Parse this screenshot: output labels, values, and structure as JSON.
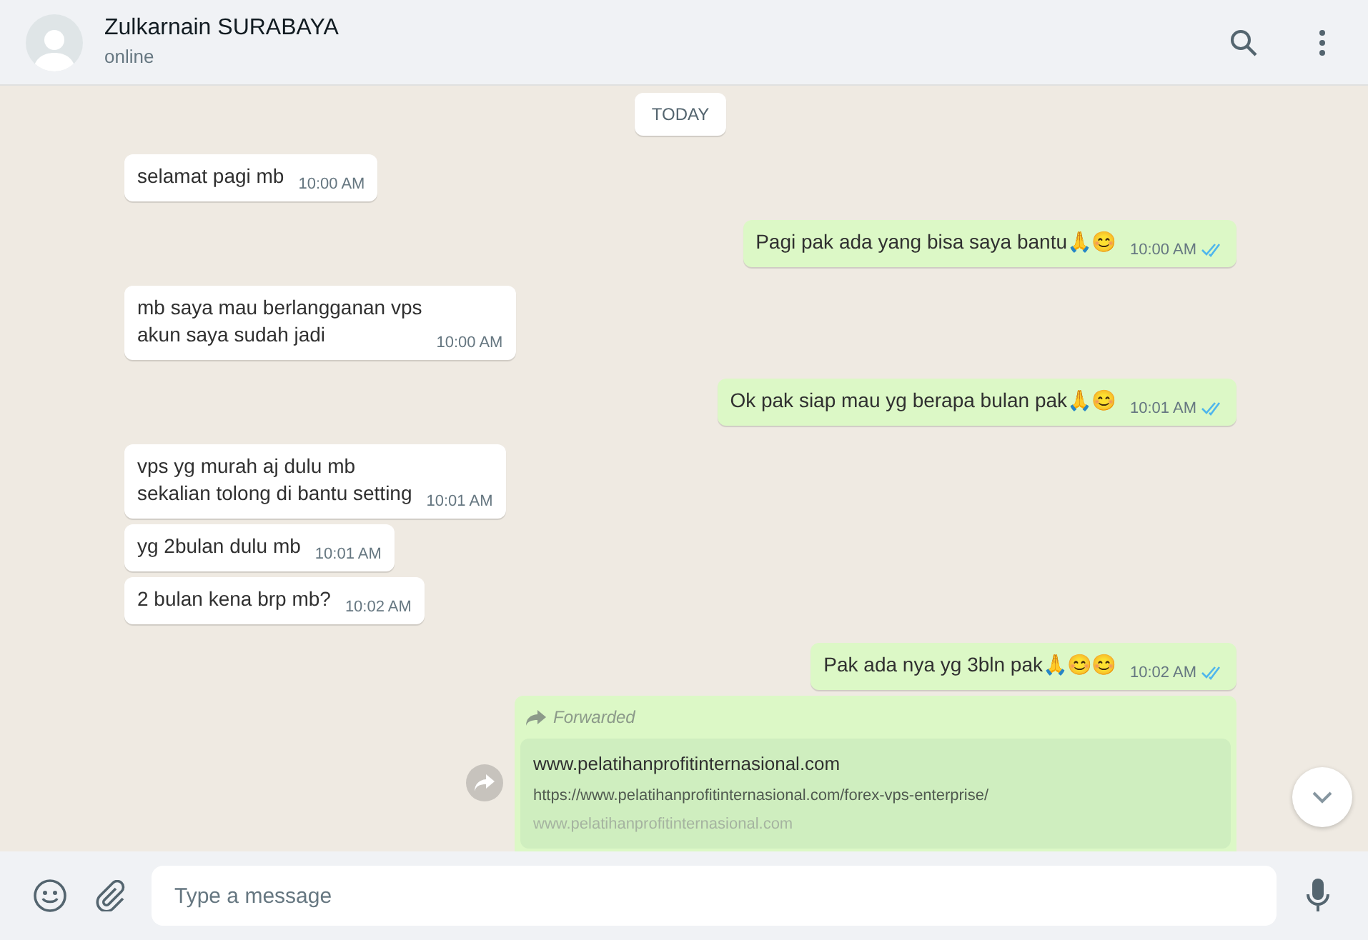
{
  "header": {
    "name": "Zulkarnain SURABAYA",
    "status": "online"
  },
  "date_chip": "TODAY",
  "messages": [
    {
      "kind": "in",
      "text": "selamat pagi mb",
      "time": "10:00 AM"
    },
    {
      "kind": "out",
      "text": "Pagi pak ada yang bisa saya bantu🙏😊",
      "time": "10:00 AM",
      "read": true
    },
    {
      "kind": "in",
      "text": "mb saya mau berlangganan vps\nakun saya sudah jadi",
      "time": "10:00 AM"
    },
    {
      "kind": "out",
      "text": "Ok pak siap mau yg berapa bulan pak🙏😊",
      "time": "10:01 AM",
      "read": true
    },
    {
      "kind": "in",
      "text": "vps yg murah aj dulu mb\nsekalian tolong di bantu setting",
      "time": "10:01 AM"
    },
    {
      "kind": "in",
      "text": "yg 2bulan dulu mb",
      "time": "10:01 AM"
    },
    {
      "kind": "in",
      "text": "2 bulan kena brp mb?",
      "time": "10:02 AM"
    },
    {
      "kind": "out",
      "text": "Pak ada nya yg 3bln pak🙏😊😊",
      "time": "10:02 AM",
      "read": true
    },
    {
      "kind": "forwarded",
      "label": "Forwarded",
      "preview_title": "www.pelatihanprofitinternasional.com",
      "preview_url": "https://www.pelatihanprofitinternasional.com/forex-vps-enterprise/",
      "preview_domain": "www.pelatihanprofitinternasional.com"
    }
  ],
  "composer": {
    "placeholder": "Type a message"
  }
}
